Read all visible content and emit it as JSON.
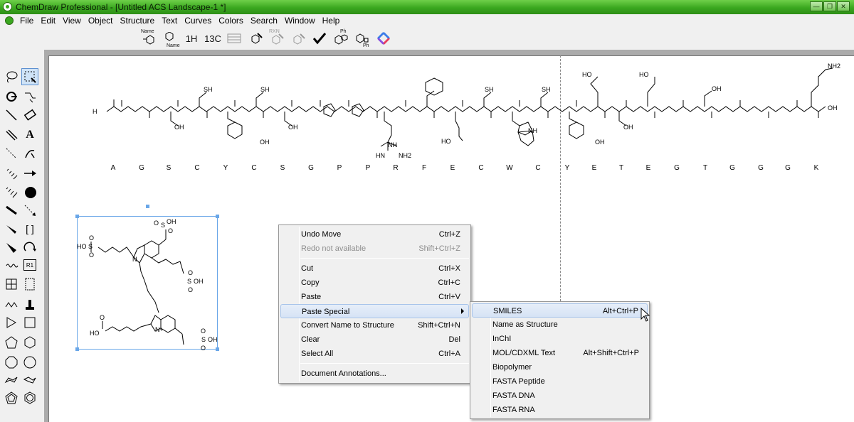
{
  "window": {
    "title": "ChemDraw Professional - [Untitled ACS Landscape-1 *]"
  },
  "menubar": {
    "items": [
      "File",
      "Edit",
      "View",
      "Object",
      "Structure",
      "Text",
      "Curves",
      "Colors",
      "Search",
      "Window",
      "Help"
    ]
  },
  "toolbar": {
    "name_to_struct": {
      "top": "Name",
      "bottom": ""
    },
    "struct_to_name": {
      "top": "",
      "bottom": "Name"
    },
    "h1_nmr": "1H",
    "c13_nmr": "13C",
    "rxn_label": "RXN",
    "ph_label": "Ph",
    "ph_label2": "Ph"
  },
  "peptide": {
    "sequence": [
      "A",
      "G",
      "S",
      "C",
      "Y",
      "C",
      "S",
      "G",
      "P",
      "P",
      "R",
      "F",
      "E",
      "C",
      "W",
      "C",
      "Y",
      "E",
      "T",
      "E",
      "G",
      "T",
      "G",
      "G",
      "G",
      "K"
    ],
    "atom_labels": [
      "SH",
      "SH",
      "SH",
      "SH",
      "OH",
      "OH",
      "OH",
      "OH",
      "HO",
      "HO",
      "NH",
      "HN",
      "NH2",
      "HO",
      "NH",
      "OH",
      "OH",
      "OH",
      "NH2",
      "H",
      "N",
      "N",
      "N",
      "N",
      "H"
    ]
  },
  "dye": {
    "labels": [
      "OH",
      "O",
      "S",
      "O",
      "HO",
      "S",
      "O",
      "O",
      "N",
      "S",
      "OH",
      "O",
      "O",
      "N+",
      "HO",
      "O",
      "S",
      "OH",
      "O",
      "O"
    ]
  },
  "context_menu": {
    "items": [
      {
        "label": "Undo Move",
        "shortcut": "Ctrl+Z"
      },
      {
        "label": "Redo not available",
        "shortcut": "Shift+Ctrl+Z"
      },
      {
        "label": "Cut",
        "shortcut": "Ctrl+X"
      },
      {
        "label": "Copy",
        "shortcut": "Ctrl+C"
      },
      {
        "label": "Paste",
        "shortcut": "Ctrl+V"
      },
      {
        "label": "Paste Special",
        "shortcut": ""
      },
      {
        "label": "Convert Name to Structure",
        "shortcut": "Shift+Ctrl+N"
      },
      {
        "label": "Clear",
        "shortcut": "Del"
      },
      {
        "label": "Select All",
        "shortcut": "Ctrl+A"
      },
      {
        "label": "Document Annotations...",
        "shortcut": ""
      }
    ]
  },
  "submenu": {
    "items": [
      {
        "label": "SMILES",
        "shortcut": "Alt+Ctrl+P"
      },
      {
        "label": "Name as Structure",
        "shortcut": ""
      },
      {
        "label": "InChI",
        "shortcut": ""
      },
      {
        "label": "MOL/CDXML Text",
        "shortcut": "Alt+Shift+Ctrl+P"
      },
      {
        "label": "Biopolymer",
        "shortcut": ""
      },
      {
        "label": "FASTA Peptide",
        "shortcut": ""
      },
      {
        "label": "FASTA DNA",
        "shortcut": ""
      },
      {
        "label": "FASTA RNA",
        "shortcut": ""
      }
    ]
  },
  "colors": {
    "titlebar": "#3aa71f",
    "selection": "#6aa7e8",
    "highlight": "#d6e3f5"
  }
}
